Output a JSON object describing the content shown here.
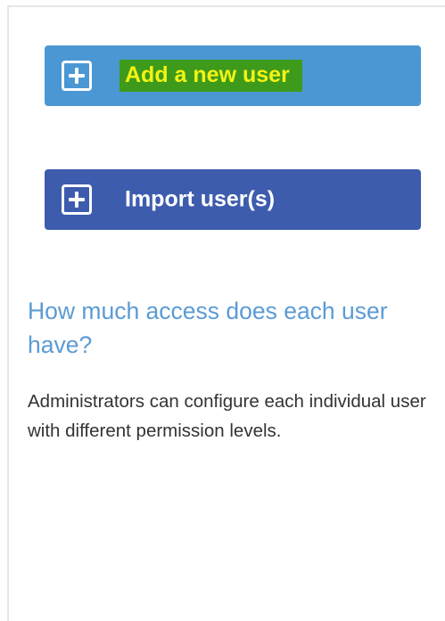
{
  "actions": {
    "add_user": {
      "label": "Add a new user",
      "icon": "plus-square-icon",
      "background": "#4a97d4",
      "highlight": "#3e9a1a",
      "label_color": "#f3f314"
    },
    "import_users": {
      "label": "Import user(s)",
      "icon": "plus-square-icon",
      "background": "#3e5cae"
    }
  },
  "info": {
    "heading": "How much access does each user have?",
    "heading_color": "#5b9bd5",
    "body": "Administrators can configure each individual user with different permission levels."
  }
}
